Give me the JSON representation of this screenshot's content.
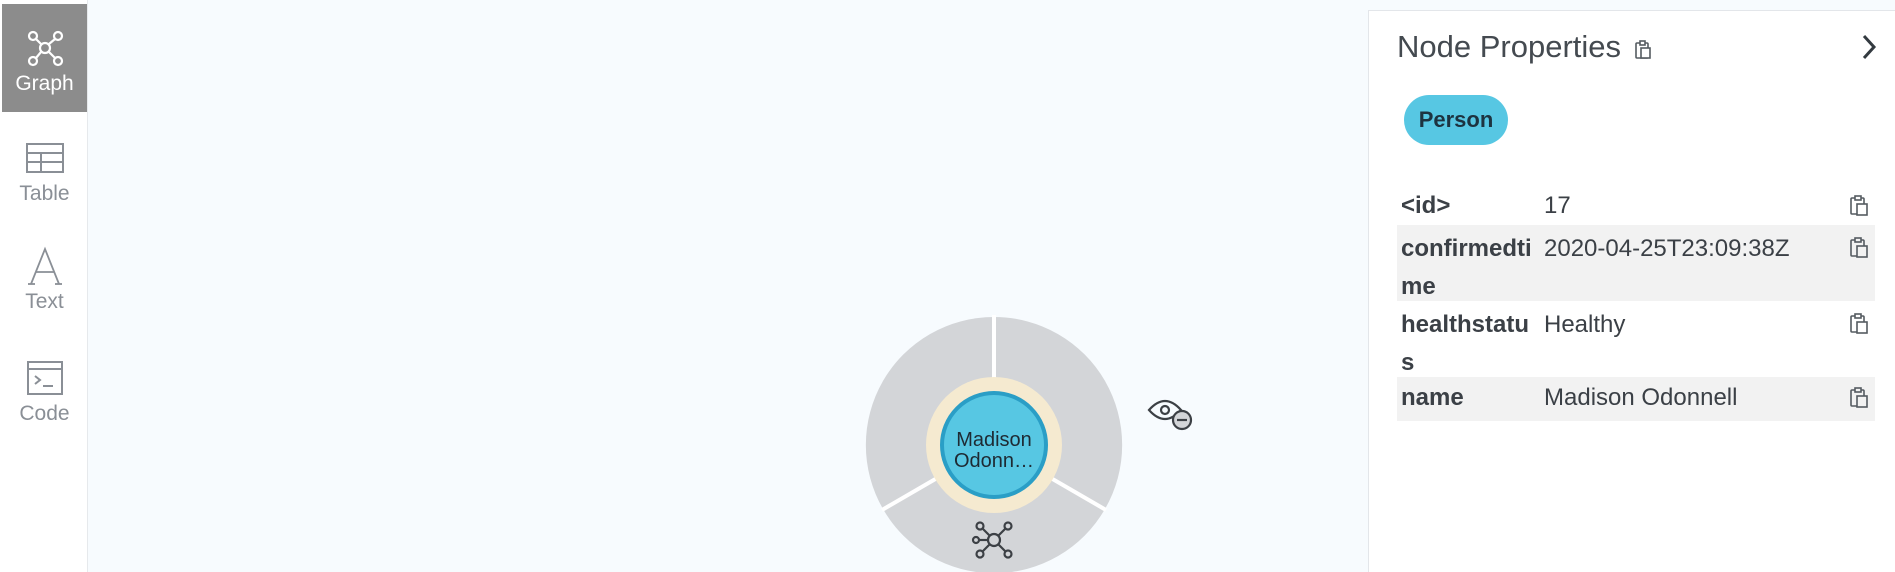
{
  "sidebar": {
    "items": [
      {
        "label": "Graph",
        "icon": "graph-icon",
        "active": true
      },
      {
        "label": "Table",
        "icon": "table-icon",
        "active": false
      },
      {
        "label": "Text",
        "icon": "text-icon",
        "active": false
      },
      {
        "label": "Code",
        "icon": "code-icon",
        "active": false
      }
    ]
  },
  "node": {
    "caption_line1": "Madison",
    "caption_line2": "Odonn…",
    "fill_color": "#57c7e3",
    "ring_color": "#f5ead0",
    "menu_color": "#d3d5d8"
  },
  "radial_menu": {
    "icons": [
      "unlock-icon",
      "hide-node-icon",
      "expand-network-icon"
    ]
  },
  "panel": {
    "title": "Node Properties",
    "label": "Person",
    "label_color": "#57c7e3",
    "properties": [
      {
        "key": "<id>",
        "value": "17"
      },
      {
        "key": "confirmedtime",
        "value": "2020-04-25T23:09:38Z"
      },
      {
        "key": "healthstatus",
        "value": "Healthy"
      },
      {
        "key": "name",
        "value": "Madison Odonnell"
      }
    ]
  }
}
